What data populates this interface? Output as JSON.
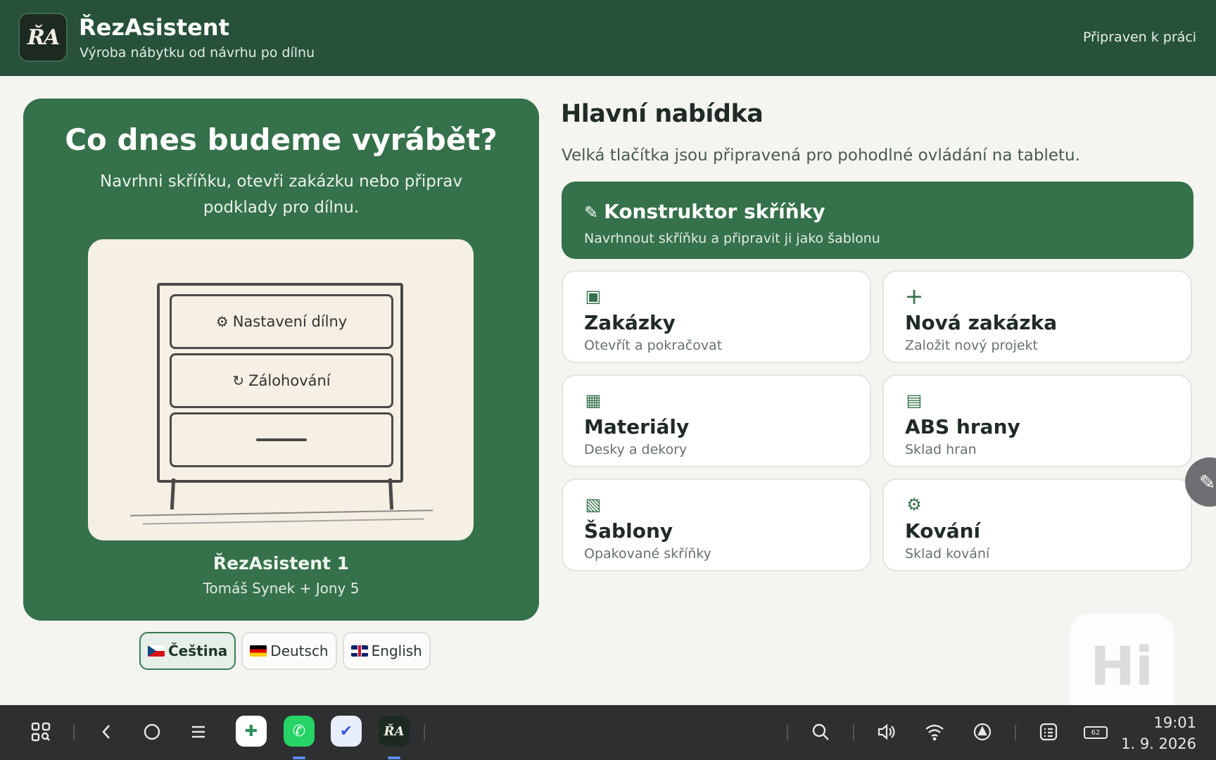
{
  "header": {
    "logo_text": "ŘA",
    "title": "ŘezAsistent",
    "subtitle": "Výroba nábytku od návrhu po dílnu",
    "status": "Připraven k práci"
  },
  "hero": {
    "title": "Co dnes budeme vyrábět?",
    "text": "Navrhni skříňku, otevři zakázku nebo připrav podklady pro dílnu.",
    "drawers": [
      {
        "icon": "gear-icon",
        "glyph": "⚙",
        "label": "Nastavení dílny"
      },
      {
        "icon": "refresh-icon",
        "glyph": "↻",
        "label": "Zálohování"
      }
    ],
    "device_name": "ŘezAsistent 1",
    "device_owner": "Tomáš Synek + Jony 5"
  },
  "languages": [
    {
      "label": "Čeština",
      "flag": "cz",
      "active": true
    },
    {
      "label": "Deutsch",
      "flag": "de",
      "active": false
    },
    {
      "label": "English",
      "flag": "gb",
      "active": false
    }
  ],
  "menu": {
    "title": "Hlavní nabídka",
    "subtitle": "Velká tlačítka jsou připravená pro pohodlné ovládání na tabletu.",
    "primary": {
      "icon": "pencil-icon",
      "glyph": "✎",
      "title": "Konstruktor skříňky",
      "subtitle": "Navrhnout skříňku a připravit ji jako šablonu"
    },
    "cards": [
      {
        "icon": "folder-square-icon",
        "glyph": "▣",
        "title": "Zakázky",
        "subtitle": "Otevřít a pokračovat"
      },
      {
        "icon": "plus-icon",
        "glyph": "+",
        "title": "Nová zakázka",
        "subtitle": "Založit nový projekt"
      },
      {
        "icon": "grid-icon",
        "glyph": "▦",
        "title": "Materiály",
        "subtitle": "Desky a dekory"
      },
      {
        "icon": "list-icon",
        "glyph": "▤",
        "title": "ABS hrany",
        "subtitle": "Sklad hran"
      },
      {
        "icon": "hatched-square-icon",
        "glyph": "▧",
        "title": "Šablony",
        "subtitle": "Opakované skříňky"
      },
      {
        "icon": "gear-icon",
        "glyph": "⚙",
        "title": "Kování",
        "subtitle": "Sklad kování"
      }
    ]
  },
  "overlay": {
    "hi_text": "Hi"
  },
  "taskbar": {
    "apps": [
      {
        "icon": "app-grid-icon",
        "glyph": "✚"
      },
      {
        "icon": "whatsapp-icon",
        "glyph": "✆"
      },
      {
        "icon": "mail-icon",
        "glyph": "✔"
      },
      {
        "icon": "rezasistent-icon",
        "glyph": "ŘA"
      }
    ],
    "battery": "62",
    "time": "19:01",
    "date": "1. 9. 2026"
  },
  "colors": {
    "header": "#27513a",
    "accent": "#35714a",
    "background": "#f4f5f1",
    "taskbar": "#2e2f31"
  }
}
